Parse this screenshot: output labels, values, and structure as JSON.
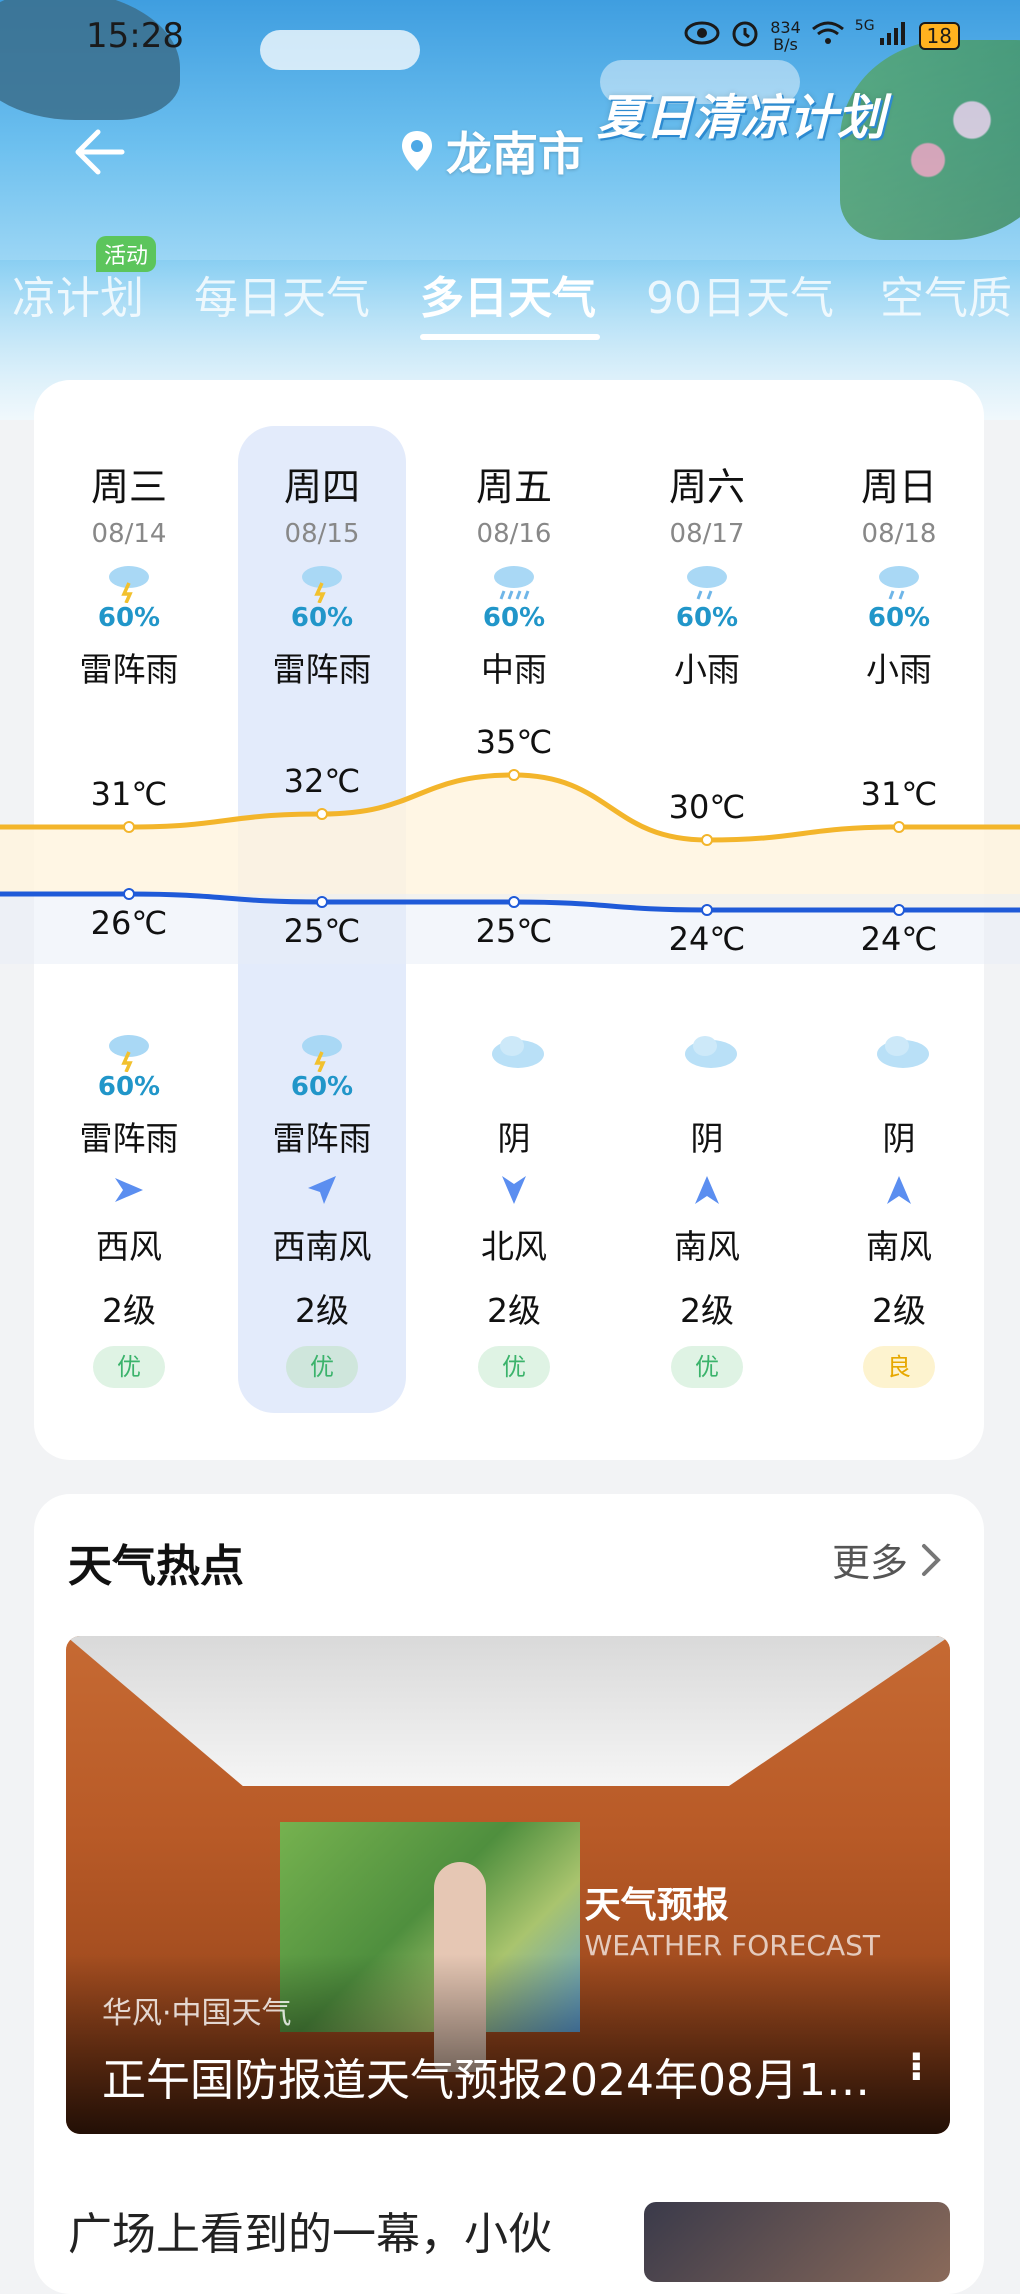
{
  "status_bar": {
    "time": "15:28",
    "net_speed_value": "834",
    "net_speed_unit": "B/s",
    "signal": "5G",
    "battery": "18"
  },
  "header": {
    "city": "龙南市",
    "banner": "夏日清凉计划"
  },
  "tabs": [
    {
      "label": "凉计划",
      "badge": "活动"
    },
    {
      "label": "每日天气"
    },
    {
      "label": "多日天气",
      "active": true
    },
    {
      "label": "90日天气"
    },
    {
      "label": "空气质"
    }
  ],
  "forecast": [
    {
      "day": "周三",
      "date": "08/14",
      "day_icon": "thunder-rain-icon",
      "day_prob": "60%",
      "day_weather": "雷阵雨",
      "high": "31℃",
      "low": "26℃",
      "high_value": 31,
      "low_value": 26,
      "night_icon": "thunder-rain-icon",
      "night_prob": "60%",
      "night_weather": "雷阵雨",
      "wind_icon": "wind-arrow-east-icon",
      "wind": "西风",
      "wind_level": "2级",
      "aqi": "优"
    },
    {
      "day": "周四",
      "date": "08/15",
      "day_icon": "thunder-rain-icon",
      "day_prob": "60%",
      "day_weather": "雷阵雨",
      "high": "32℃",
      "low": "25℃",
      "high_value": 32,
      "low_value": 25,
      "night_icon": "thunder-rain-icon",
      "night_prob": "60%",
      "night_weather": "雷阵雨",
      "wind_icon": "wind-arrow-northeast-icon",
      "wind": "西南风",
      "wind_level": "2级",
      "aqi": "优"
    },
    {
      "day": "周五",
      "date": "08/16",
      "day_icon": "moderate-rain-icon",
      "day_prob": "60%",
      "day_weather": "中雨",
      "high": "35℃",
      "low": "25℃",
      "high_value": 35,
      "low_value": 25,
      "night_icon": "overcast-icon",
      "night_prob": "",
      "night_weather": "阴",
      "wind_icon": "wind-arrow-south-icon",
      "wind": "北风",
      "wind_level": "2级",
      "aqi": "优"
    },
    {
      "day": "周六",
      "date": "08/17",
      "day_icon": "light-rain-icon",
      "day_prob": "60%",
      "day_weather": "小雨",
      "high": "30℃",
      "low": "24℃",
      "high_value": 30,
      "low_value": 24,
      "night_icon": "overcast-icon",
      "night_prob": "",
      "night_weather": "阴",
      "wind_icon": "wind-arrow-north-icon",
      "wind": "南风",
      "wind_level": "2级",
      "aqi": "优"
    },
    {
      "day": "周日",
      "date": "08/18",
      "day_icon": "light-rain-icon",
      "day_prob": "60%",
      "day_weather": "小雨",
      "high": "31℃",
      "low": "24℃",
      "high_value": 31,
      "low_value": 24,
      "night_icon": "overcast-icon",
      "night_prob": "",
      "night_weather": "阴",
      "wind_icon": "wind-arrow-north-icon",
      "wind": "南风",
      "wind_level": "2级",
      "aqi": "良"
    }
  ],
  "colors": {
    "high_line": "#f3b52b",
    "low_line": "#1f5ad8",
    "prob": "#2196c9",
    "aq_good": "#3bb36b",
    "aq_mid": "#e7a800"
  },
  "news": {
    "section_title": "天气热点",
    "more_label": "更多",
    "video": {
      "source": "华风·中国天气",
      "title": "正午国防报道天气预报2024年08月1…",
      "brand_title": "天气预报",
      "brand_sub": "WEATHER FORECAST"
    },
    "next_title": "广场上看到的一幕，小伙"
  }
}
